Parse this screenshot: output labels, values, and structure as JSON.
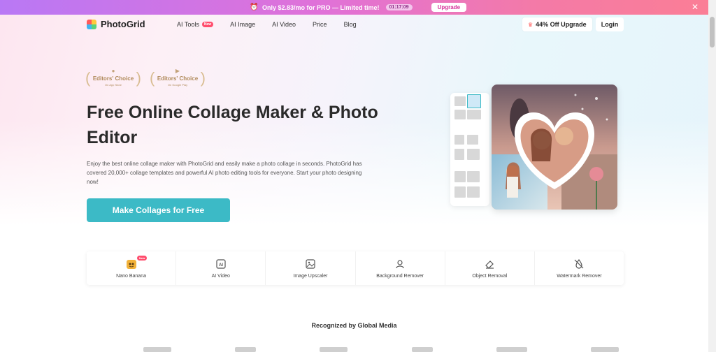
{
  "promo_bar": {
    "text": "Only $2.83/mo for PRO — Limited time!",
    "timer": "01:17:09",
    "upgrade_label": "Upgrade",
    "close_glyph": "✕"
  },
  "header": {
    "logo_text": "PhotoGrid",
    "menu": [
      {
        "label": "AI Tools",
        "badge": "New"
      },
      {
        "label": "AI Image"
      },
      {
        "label": "AI Video"
      },
      {
        "label": "Price"
      },
      {
        "label": "Blog"
      }
    ],
    "offer_label": "44% Off Upgrade",
    "login_label": "Login"
  },
  "awards": [
    {
      "title": "Editors' Choice",
      "sub": "On App Store",
      "icon": "apple-icon"
    },
    {
      "title": "Editors' Choice",
      "sub": "On Google Play",
      "icon": "google-play-icon"
    }
  ],
  "hero": {
    "headline": "Free Online Collage Maker & Photo Editor",
    "description": "Enjoy the best online collage maker with PhotoGrid and easily make a photo collage in seconds. PhotoGrid has covered 20,000+ collage templates and powerful AI photo editing tools for everyone. Start your photo designing now!",
    "cta_label": "Make Collages for Free"
  },
  "tools": [
    {
      "label": "Nano Banana",
      "badge": "New",
      "icon": "banana-icon"
    },
    {
      "label": "AI Video",
      "icon": "ai-video-icon"
    },
    {
      "label": "Image Upscaler",
      "icon": "image-upscale-icon"
    },
    {
      "label": "Background Remover",
      "icon": "person-cutout-icon"
    },
    {
      "label": "Object Removal",
      "icon": "eraser-icon"
    },
    {
      "label": "Watermark Remover",
      "icon": "watermark-off-icon"
    }
  ],
  "media": {
    "heading": "Recognized by Global Media"
  },
  "colors": {
    "accent": "#3cbac6",
    "badge": "#ff4d6d",
    "award": "#b08a5a"
  }
}
